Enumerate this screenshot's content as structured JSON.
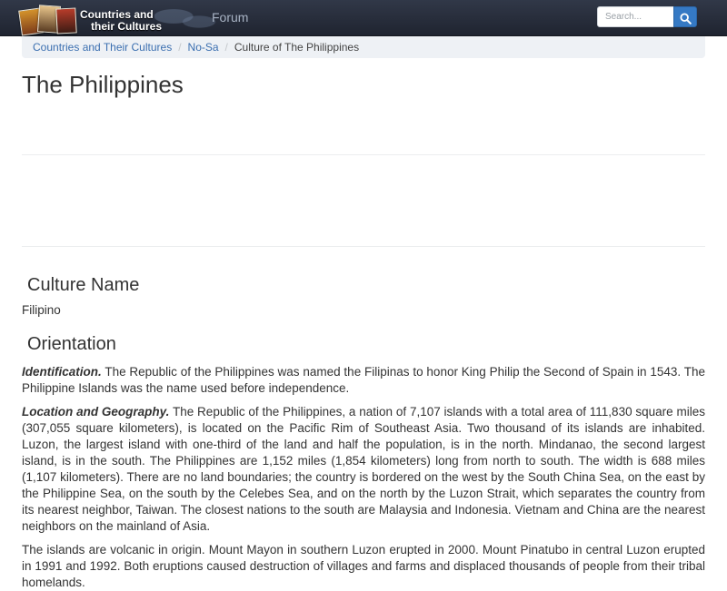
{
  "navbar": {
    "brand_line1": "Countries and",
    "brand_line2": "their Cultures",
    "forum_label": "Forum",
    "search_placeholder": "Search...",
    "background_color": "#2a2f3a",
    "search_button_color": "#3579c4",
    "search_icon": "search-icon"
  },
  "breadcrumb": {
    "items": [
      "Countries and Their Cultures",
      "No-Sa"
    ],
    "current": "Culture of The Philippines",
    "separator": "/",
    "link_color": "#3b6fb0"
  },
  "page": {
    "title": "The Philippines"
  },
  "sections": {
    "culture_name": {
      "heading": "Culture Name",
      "text": "Filipino"
    },
    "orientation": {
      "heading": "Orientation",
      "identification_lead": "Identification.",
      "identification_text": " The Republic of the Philippines was named the Filipinas to honor King Philip the Second of Spain in 1543. The Philippine Islands was the name used before independence.",
      "location_lead": "Location and Geography.",
      "location_text": " The Republic of the Philippines, a nation of 7,107 islands with a total area of 111,830 square miles (307,055 square kilometers), is located on the Pacific Rim of Southeast Asia. Two thousand of its islands are inhabited. Luzon, the largest island with one-third of the land and half the population, is in the north. Mindanao, the second largest island, is in the south. The Philippines are 1,152 miles (1,854 kilometers) long from north to south. The width is 688 miles (1,107 kilometers). There are no land boundaries; the country is bordered on the west by the South China Sea, on the east by the Philippine Sea, on the south by the Celebes Sea, and on the north by the Luzon Strait, which separates the country from its nearest neighbor, Taiwan. The closest nations to the south are Malaysia and Indonesia. Vietnam and China are the nearest neighbors on the mainland of Asia.",
      "volcanic_text": "The islands are volcanic in origin. Mount Mayon in southern Luzon erupted in 2000. Mount Pinatubo in central Luzon erupted in 1991 and 1992. Both eruptions caused destruction of villages and farms and displaced thousands of people from their tribal homelands."
    }
  }
}
